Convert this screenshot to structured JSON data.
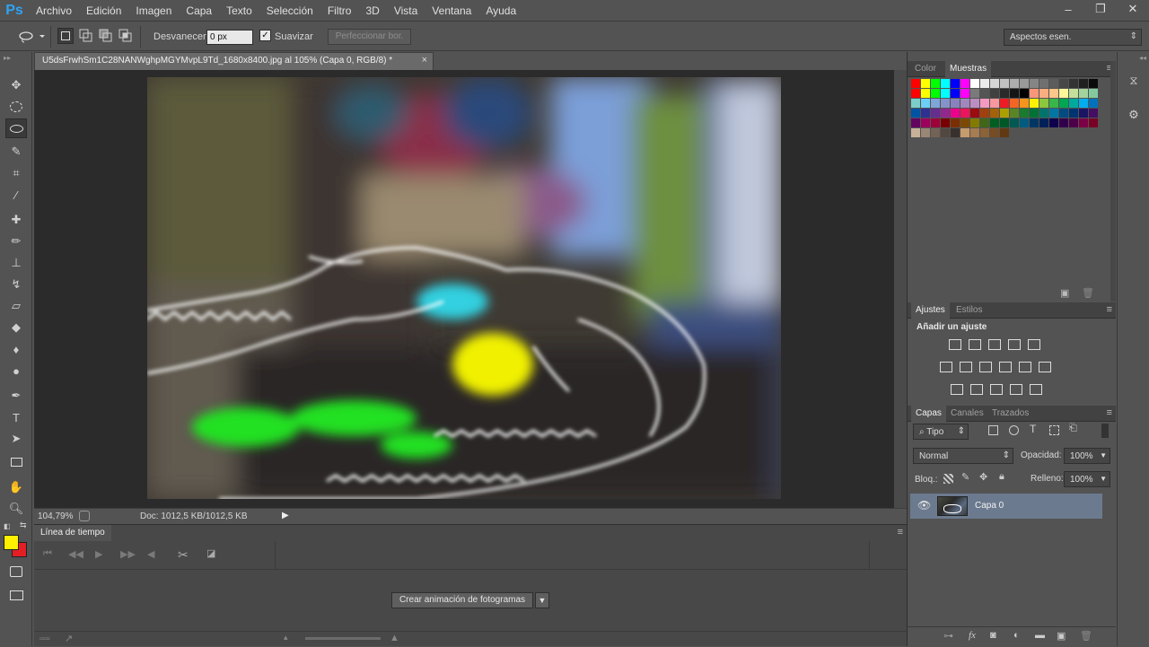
{
  "app": {
    "logo": "Ps"
  },
  "menu": [
    "Archivo",
    "Edición",
    "Imagen",
    "Capa",
    "Texto",
    "Selección",
    "Filtro",
    "3D",
    "Vista",
    "Ventana",
    "Ayuda"
  ],
  "window": {
    "minimize": "‒",
    "restore": "❐",
    "close": "✕"
  },
  "options": {
    "feather_label": "Desvanecer:",
    "feather_value": "0 px",
    "smooth_label": "Suavizar",
    "refine_label": "Perfeccionar bor.",
    "workspace": "Aspectos esen."
  },
  "document": {
    "tab_title": "U5dsFrwhSm1C28NANWghpMGYMvpL9Td_1680x8400.jpg al 105% (Capa 0, RGB/8) *",
    "close": "×"
  },
  "status": {
    "zoom": "104,79%",
    "doc_info": "Doc: 1012,5 KB/1012,5 KB"
  },
  "timeline": {
    "tab": "Línea de tiempo",
    "create_button": "Crear animación de fotogramas"
  },
  "swatches_panel": {
    "tabs": [
      "Color",
      "Muestras"
    ],
    "active": "Muestras",
    "colors": [
      "#ff0000",
      "#ffff00",
      "#00ff00",
      "#00ffff",
      "#0000ff",
      "#ff00ff",
      "#ffffff",
      "#ebebeb",
      "#d6d6d6",
      "#c2c2c2",
      "#adadad",
      "#999999",
      "#858585",
      "#707070",
      "#5c5c5c",
      "#474747",
      "#333333",
      "#1f1f1f",
      "#0a0a0a",
      "#ff0000",
      "#ffff00",
      "#00ff00",
      "#00ffff",
      "#0000ff",
      "#ff00ff",
      "#7a7a7a",
      "#555555",
      "#404040",
      "#2a2a2a",
      "#151515",
      "#000000",
      "#f7977a",
      "#f9ad81",
      "#fdc68a",
      "#fff79a",
      "#c4df9b",
      "#a3d39c",
      "#82ca9d",
      "#7bcdc8",
      "#6ecff6",
      "#7ea7d8",
      "#8493ca",
      "#8882be",
      "#a187be",
      "#bc8dbf",
      "#f49ac2",
      "#f6989d",
      "#ed1c24",
      "#f26522",
      "#f7941d",
      "#fff200",
      "#8dc63f",
      "#39b54a",
      "#00a651",
      "#00a99d",
      "#00aeef",
      "#0072bc",
      "#0054a6",
      "#2e3192",
      "#662d91",
      "#92278f",
      "#ec008c",
      "#ed145b",
      "#9e0b0f",
      "#a0410d",
      "#a36209",
      "#aba000",
      "#598527",
      "#1a7b30",
      "#007236",
      "#00746b",
      "#0076a3",
      "#004b80",
      "#003471",
      "#1b1464",
      "#440e62",
      "#630460",
      "#9e005d",
      "#9e0039",
      "#790000",
      "#7b2e00",
      "#7d4900",
      "#827b00",
      "#406618",
      "#005e20",
      "#005826",
      "#005952",
      "#005b7f",
      "#003663",
      "#002157",
      "#0d004c",
      "#32004b",
      "#4b0049",
      "#7b0046",
      "#7a0026",
      "#c7b299",
      "#998675",
      "#736357",
      "#534741",
      "#37302d",
      "#c69c6d",
      "#a67c52",
      "#8c6239",
      "#754c24",
      "#603913"
    ]
  },
  "adjustments_panel": {
    "tabs": [
      "Ajustes",
      "Estilos"
    ],
    "active": "Ajustes",
    "heading": "Añadir un ajuste"
  },
  "layers_panel": {
    "tabs": [
      "Capas",
      "Canales",
      "Trazados"
    ],
    "active": "Capas",
    "filter": "Tipo",
    "blend_mode": "Normal",
    "opacity_label": "Opacidad:",
    "opacity_value": "100%",
    "lock_label": "Bloq.:",
    "fill_label": "Relleno:",
    "fill_value": "100%",
    "layers": [
      {
        "name": "Capa 0"
      }
    ]
  },
  "colors": {
    "foreground": "#ffef00",
    "background": "#e31e24",
    "selected_layer": "#6c7a8f"
  }
}
